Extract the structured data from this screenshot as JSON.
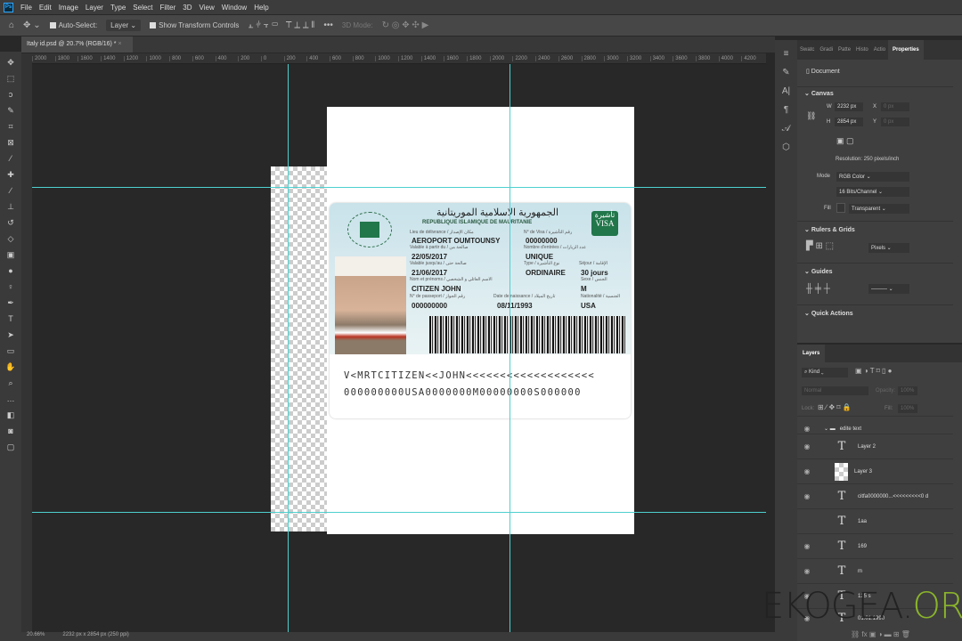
{
  "app": {
    "logo": "Ps"
  },
  "menu": [
    "File",
    "Edit",
    "Image",
    "Layer",
    "Type",
    "Select",
    "Filter",
    "3D",
    "View",
    "Window",
    "Help"
  ],
  "options": {
    "auto_select": "Auto-Select:",
    "auto_select_target": "Layer",
    "show_transform": "Show Transform Controls",
    "more": "•••",
    "mode_3d": "3D Mode:"
  },
  "tab": {
    "title": "Italy id.psd @ 20.7% (RGB/16) *",
    "close": "×"
  },
  "ruler_top": [
    "2000",
    "1800",
    "1600",
    "1400",
    "1200",
    "1000",
    "800",
    "600",
    "400",
    "200",
    "0",
    "200",
    "400",
    "600",
    "800",
    "1000",
    "1200",
    "1400",
    "1600",
    "1800",
    "2000",
    "2200",
    "2400",
    "2600",
    "2800",
    "3000",
    "3200",
    "3400",
    "3600",
    "3800",
    "4000",
    "4200"
  ],
  "card": {
    "header_ar": "الجمهورية الاسلامية الموريتانية",
    "header_fr": "REPUBLIQUE ISLAMIQUE DE MAURITANIE",
    "visa_ar": "تأشيرة",
    "visa": "VISA",
    "labels": {
      "lieu": "Lieu de délivrance / مكان الإصدار",
      "no_visa": "N° de Visa / رقم التأشيرة",
      "valable": "Valable à partir du / صالحة من",
      "entries": "Nombre d'entrées / عدد الزيارات",
      "valid_until": "Valable jusqu'au / صالحة حتى",
      "type": "Type / نوع التأشيرة",
      "sejour": "Séjour / الإقامة",
      "nom": "Nom et prénoms / الاسم العائلي و الشخصي",
      "sexe": "Sexe / الجنس",
      "passport": "N° de passeport / رقم الجواز",
      "dob": "Date de naissance / تاريخ الميلاد",
      "nat": "Nationalité / الجنسية"
    },
    "values": {
      "lieu": "AEROPORT OUMTOUNSY",
      "no_visa": "00000000",
      "valable": "22/05/2017",
      "entries": "UNIQUE",
      "valid_until": "21/06/2017",
      "type": "ORDINAIRE",
      "sejour": "30 jours",
      "nom": "CITIZEN JOHN",
      "sexe": "M",
      "passport": "000000000",
      "dob": "08/11/1993",
      "nat": "USA"
    },
    "mrz1": "V<MRTCITIZEN<<JOHN<<<<<<<<<<<<<<<<<<<",
    "mrz2": "000000000USA0000000M00000000S000000"
  },
  "status": {
    "zoom": "20.66%",
    "doc": "2232 px x 2854 px (250 ppi)"
  },
  "properties": {
    "tabs": [
      "Swatc",
      "Gradi",
      "Patte",
      "Histo",
      "Actio",
      "Properties"
    ],
    "document": "Document",
    "canvas": "Canvas",
    "w_label": "W",
    "w": "2232 px",
    "h_label": "H",
    "h": "2854 px",
    "x_label": "X",
    "x": "0 px",
    "y_label": "Y",
    "y": "0 px",
    "resolution": "Resolution: 250 pixels/inch",
    "mode_label": "Mode",
    "mode": "RGB Color",
    "depth": "16 Bits/Channel",
    "fill_label": "Fill",
    "fill": "Transparent",
    "rulers": "Rulers & Grids",
    "units": "Pixels",
    "guides": "Guides",
    "quick": "Quick Actions"
  },
  "layers": {
    "title": "Layers",
    "kind": "Kind",
    "blend": "Normal",
    "opacity_label": "Opacity:",
    "opacity": "100%",
    "lock_label": "Lock:",
    "fill_label": "Fill:",
    "fill": "100%",
    "items": [
      {
        "name": "edite text",
        "type": "group"
      },
      {
        "name": "Layer 2",
        "type": "text"
      },
      {
        "name": "Layer 3",
        "type": "image"
      },
      {
        "name": "citfa0000000...<<<<<<<<<0 d",
        "type": "text"
      },
      {
        "name": "1aa",
        "type": "text"
      },
      {
        "name": "169",
        "type": "text"
      },
      {
        "name": "m",
        "type": "text"
      },
      {
        "name": "125 s",
        "type": "text"
      },
      {
        "name": "01.01.1990",
        "type": "text"
      }
    ]
  },
  "watermark": {
    "main": "EKOGEA.",
    "accent": "ORG"
  }
}
